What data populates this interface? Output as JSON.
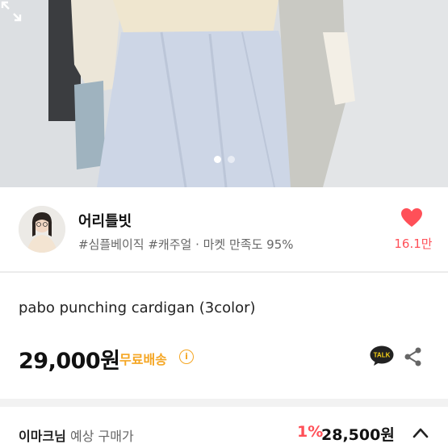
{
  "carousel": {
    "page_count": 2,
    "active_index": 0
  },
  "seller": {
    "name": "어리틀빗",
    "meta": "#심플베이직 #캐주얼 · 마켓 만족도 95%",
    "likes": "16.1만"
  },
  "product": {
    "title": "pabo punching cardigan (3color)",
    "price": "29,000원",
    "shipping": "무료배송",
    "info_glyph": "i"
  },
  "estimate": {
    "user": "이마크님",
    "label": " 예상 구매가",
    "discount": "1%",
    "price": "28,500원"
  },
  "icons": {
    "expand": "expand-icon",
    "heart": "heart-icon",
    "talk": "kakaotalk-icon",
    "share": "share-icon",
    "chevron": "chevron-up-icon"
  },
  "colors": {
    "accent_red": "#ff5058",
    "shipping_orange": "#f5a623",
    "talk_yellow": "#f7d117"
  }
}
